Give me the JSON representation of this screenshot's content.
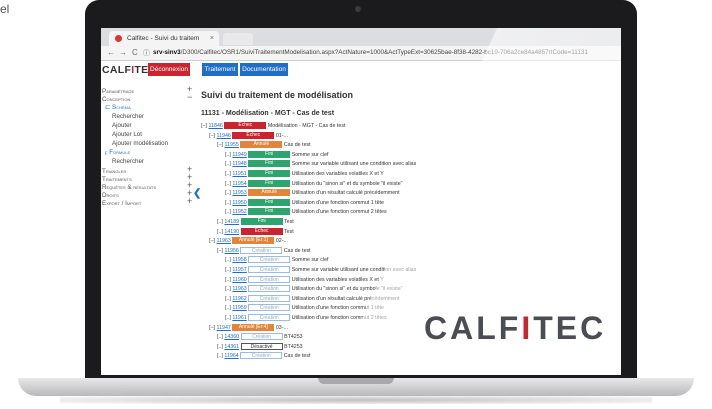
{
  "corner": {
    "text": "el"
  },
  "browser": {
    "tab_title": "Calfitec - Suivi du traitem",
    "tab_close": "×",
    "back": "←",
    "forward": "→",
    "reload": "C",
    "url_host": "srv-sinv3",
    "url_rest": "/D300/Calfitec/OSR1/SuiviTraitementModelisation.aspx?ActNature=1000&ActTypeExt=30625bae-8f38-4282-bc19-706a2ce84a4857rtCode=11131"
  },
  "app": {
    "logo_main": "CALF",
    "logo_accent": "I",
    "logo_end": "TEC",
    "deconnexion": "Déconnexion",
    "traitement": "Traitement",
    "documentation": "Documentation"
  },
  "sidebar": {
    "parametrage": "Paramétrage",
    "conception": "Conception",
    "schema": "Schéma",
    "rechercher1": "Rechercher",
    "ajouter": "Ajouter",
    "ajouter_lot": "Ajouter Lot",
    "ajouter_modelisation": "Ajouter modélisation",
    "formule": "Formule",
    "rechercher2": "Rechercher",
    "triangles": "Triangles",
    "traitements": "Traitements",
    "requetes": "Requêtes & résultats",
    "droits": "Droits",
    "export": "Export / Import",
    "plus": "+",
    "minus": "−",
    "collapse": "❮"
  },
  "main": {
    "title": "Suivi du traitement de modélisation",
    "subtitle": "11131 - Modélisation - MGT - Cas de test",
    "rows": [
      {
        "toggle": "[−]",
        "id": "11846",
        "status": "Echec",
        "st": "echec",
        "desc": "Modélisation - MGT - Cas de test"
      },
      {
        "toggle": "[−]",
        "id": "11946",
        "status": "Echec",
        "st": "echec",
        "desc": "01-..."
      },
      {
        "toggle": "[−]",
        "id": "11955",
        "status": "Annulé",
        "st": "annule",
        "desc": "Cas de test"
      },
      {
        "toggle": "[..]",
        "id": "11949",
        "status": "Fini",
        "st": "fini",
        "desc": "Somme sur clef"
      },
      {
        "toggle": "[..]",
        "id": "11948",
        "status": "Fini",
        "st": "fini",
        "desc": "Somme sur variable utilisant une condition avec alias"
      },
      {
        "toggle": "[..]",
        "id": "11951",
        "status": "Fini",
        "st": "fini",
        "desc": "Utilisation des variables volatiles X et Y"
      },
      {
        "toggle": "[..]",
        "id": "11954",
        "status": "Fini",
        "st": "fini",
        "desc": "Utilisation du \"sinon si\" et du symbole \"il existe\""
      },
      {
        "toggle": "[..]",
        "id": "11953",
        "status": "Annulé",
        "st": "annule",
        "desc": "Utilisation d'un résultat calculé précédemment"
      },
      {
        "toggle": "[..]",
        "id": "11950",
        "status": "Fini",
        "st": "fini",
        "desc": "Utilisation d'une fonction commut 1 tête"
      },
      {
        "toggle": "[..]",
        "id": "11952",
        "status": "Fini",
        "st": "fini",
        "desc": "Utilisation d'une fonction commut 2 têtes"
      },
      {
        "toggle": "[..]",
        "id": "14189",
        "status": "Fini",
        "st": "fini",
        "desc": "Test"
      },
      {
        "toggle": "[..]",
        "id": "14190",
        "status": "Echec",
        "st": "echec",
        "desc": "Test"
      },
      {
        "toggle": "[−]",
        "id": "11963",
        "status": "Annulé [Er:1]",
        "st": "annule",
        "desc": "02-..."
      },
      {
        "toggle": "[−]",
        "id": "11956",
        "status": "Création",
        "st": "creation",
        "desc": "Cas de test"
      },
      {
        "toggle": "[..]",
        "id": "11958",
        "status": "Création",
        "st": "creation",
        "desc": "Somme sur clef"
      },
      {
        "toggle": "[..]",
        "id": "11957",
        "status": "Création",
        "st": "creation",
        "desc": "Somme sur variable utilisant une condition avec alias"
      },
      {
        "toggle": "[..]",
        "id": "11960",
        "status": "Création",
        "st": "creation",
        "desc": "Utilisation des variables volatiles X et Y"
      },
      {
        "toggle": "[..]",
        "id": "11963",
        "status": "Création",
        "st": "creation",
        "desc": "Utilisation du \"sinon si\" et du symbole \"il existe\""
      },
      {
        "toggle": "[..]",
        "id": "11962",
        "status": "Création",
        "st": "creation",
        "desc": "Utilisation d'un résultat calculé précédemment"
      },
      {
        "toggle": "[..]",
        "id": "11959",
        "status": "Création",
        "st": "creation",
        "desc": "Utilisation d'une fonction commut 1 tête"
      },
      {
        "toggle": "[..]",
        "id": "11961",
        "status": "Création",
        "st": "creation",
        "desc": "Utilisation d'une fonction commut 2 têtes"
      },
      {
        "toggle": "[−]",
        "id": "11947",
        "status": "Annulé [Er:4]",
        "st": "annule",
        "desc": "03-..."
      },
      {
        "toggle": "[..]",
        "id": "14360",
        "status": "Création",
        "st": "creation",
        "desc": "BT4253"
      },
      {
        "toggle": "[..]",
        "id": "14361",
        "status": "Désactivé",
        "st": "desactive",
        "desc": "BT4253"
      },
      {
        "toggle": "[..]",
        "id": "11964",
        "status": "Création",
        "st": "creation",
        "desc": "Cas de test"
      }
    ]
  },
  "watermark": {
    "main": "CALF",
    "accent": "I",
    "end": "TEC"
  },
  "colors": {
    "red": "#c9242f",
    "blue": "#1f6ec8",
    "green": "#2ea56e",
    "orange": "#e2843a"
  }
}
